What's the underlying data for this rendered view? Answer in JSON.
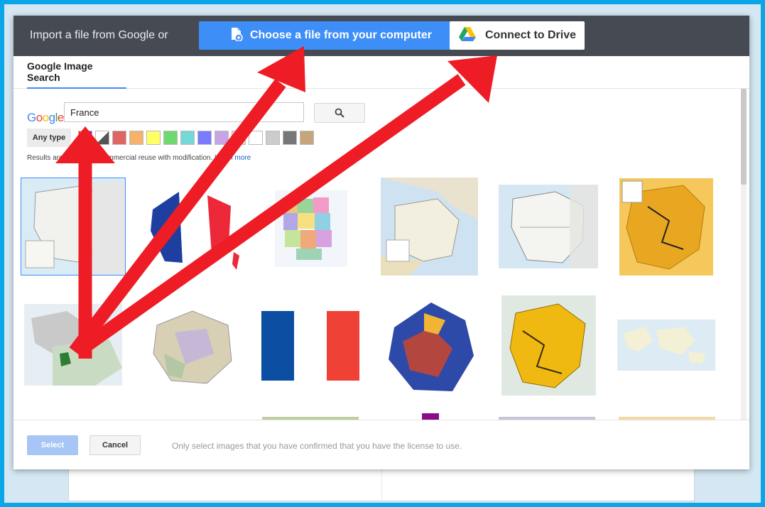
{
  "topbar": {
    "prompt": "Import a file from Google or",
    "upload_label": "Choose a file from your computer",
    "drive_label": "Connect to Drive"
  },
  "tabs": [
    {
      "label": "Google Image Search",
      "active": true
    }
  ],
  "search": {
    "logo": "Google",
    "query": "France",
    "any_type_label": "Any type",
    "results_note": "Results are labeled for commercial reuse with modification.",
    "learn_more": "Learn more",
    "swatch_colors": [
      "rainbow",
      "halftone",
      "#e06666",
      "#f6b26b",
      "#ffff66",
      "#6fd86f",
      "#76d7d7",
      "#7b7bff",
      "#c7a4e6",
      "#ffc7dc",
      "#ffffff",
      "#cccccc",
      "#777777",
      "#c7a57a"
    ]
  },
  "footer": {
    "select_label": "Select",
    "cancel_label": "Cancel",
    "note": "Only select images that you have confirmed that you have the license to use."
  },
  "colors": {
    "frame": "#0aa7e8",
    "topbar": "#464a52",
    "accent": "#3e8ef7",
    "annotation_arrow": "#ee1c25"
  },
  "icons": [
    "upload-file-icon",
    "google-drive-icon",
    "search-icon"
  ]
}
